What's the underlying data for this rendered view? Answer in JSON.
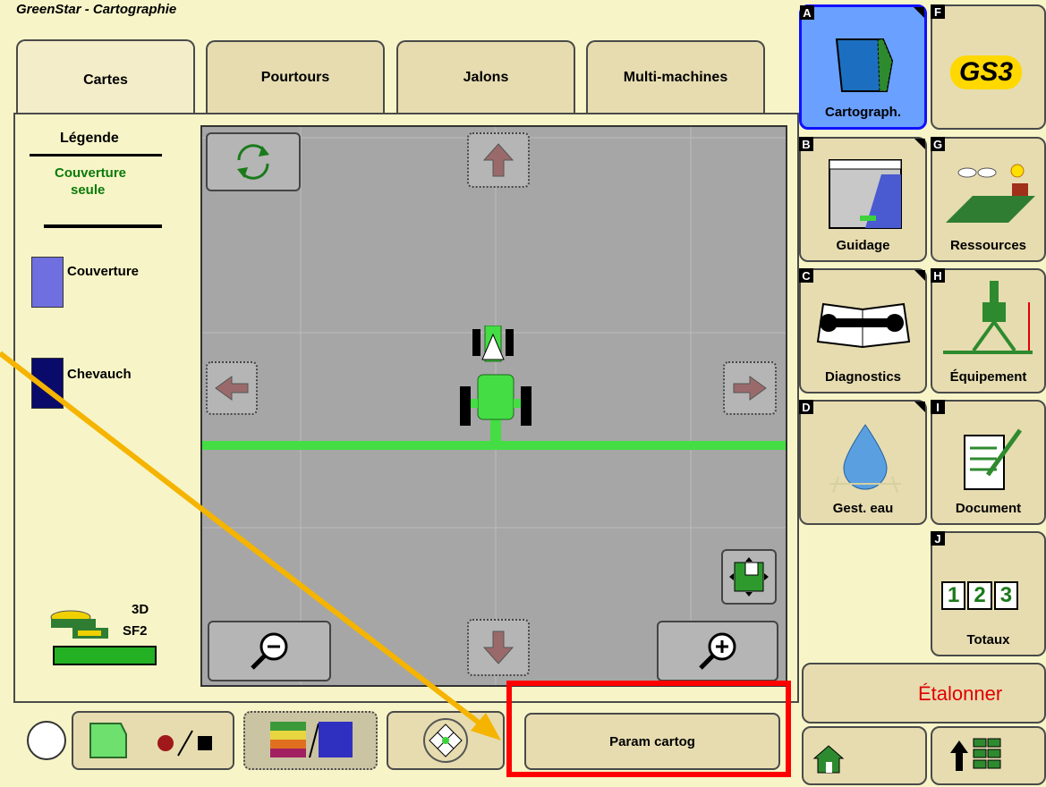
{
  "app": {
    "title": "GreenStar - Cartographie"
  },
  "tabs": [
    {
      "label": "Cartes",
      "active": true
    },
    {
      "label": "Pourtours",
      "active": false
    },
    {
      "label": "Jalons",
      "active": false
    },
    {
      "label": "Multi-machines",
      "active": false
    }
  ],
  "legend": {
    "title": "Légende",
    "mode_line1": "Couverture",
    "mode_line2": "seule",
    "items": [
      {
        "label": "Couverture",
        "color": "#6f6fe0"
      },
      {
        "label": "Chevauch",
        "color": "#0a0a6a"
      }
    ]
  },
  "gps": {
    "mode": "3D",
    "signal": "SF2"
  },
  "bottom": {
    "param_label": "Param cartog"
  },
  "side_menu": [
    {
      "letter": "A",
      "label": "Cartograph.",
      "selected": true
    },
    {
      "letter": "F",
      "label": "GS3",
      "selected": false
    },
    {
      "letter": "B",
      "label": "Guidage",
      "selected": false
    },
    {
      "letter": "G",
      "label": "Ressources",
      "selected": false
    },
    {
      "letter": "C",
      "label": "Diagnostics",
      "selected": false
    },
    {
      "letter": "H",
      "label": "Équipement",
      "selected": false
    },
    {
      "letter": "D",
      "label": "Gest. eau",
      "selected": false
    },
    {
      "letter": "I",
      "label": "Document",
      "selected": false
    },
    {
      "letter": "J",
      "label": "Totaux",
      "selected": false
    }
  ],
  "totaux_digits": [
    "1",
    "2",
    "3"
  ],
  "calibrate_label": "Étalonner",
  "colors": {
    "accent_green": "#3cd23c",
    "calibrate_red": "#e00000",
    "highlight_red": "#ff0000",
    "arrow_orange": "#f5b400"
  }
}
